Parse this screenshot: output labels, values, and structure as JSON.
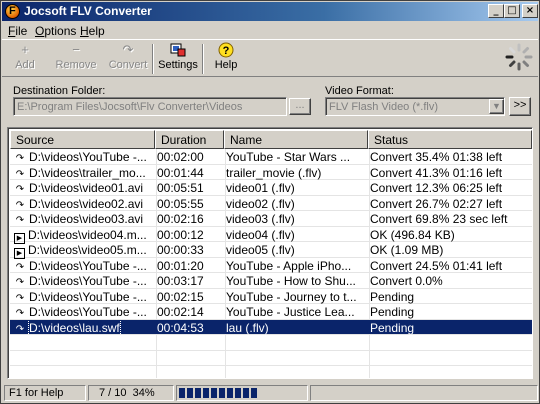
{
  "window": {
    "title": "Jocsoft FLV Converter",
    "app_icon_letter": "F"
  },
  "menu": [
    {
      "label": "File",
      "underline": "F"
    },
    {
      "label": "Options",
      "underline": "O"
    },
    {
      "label": "Help",
      "underline": "H"
    }
  ],
  "toolbar": {
    "add": {
      "label": "Add",
      "icon": "plus-icon",
      "enabled": false
    },
    "remove": {
      "label": "Remove",
      "icon": "minus-icon",
      "enabled": false
    },
    "convert": {
      "label": "Convert",
      "icon": "convert-icon",
      "enabled": false
    },
    "settings": {
      "label": "Settings",
      "icon": "settings-icon",
      "enabled": true
    },
    "help": {
      "label": "Help",
      "icon": "question-icon",
      "enabled": true
    }
  },
  "destination": {
    "label": "Destination Folder:",
    "value": "E:\\Program Files\\Jocsoft\\Flv Converter\\Videos",
    "browse_label": "..."
  },
  "format": {
    "label": "Video Format:",
    "value": "FLV Flash Video (*.flv)",
    "next_label": ">>"
  },
  "columns": [
    "Source",
    "Duration",
    "Name",
    "Status"
  ],
  "rows": [
    {
      "icon": "convert",
      "source": "D:\\videos\\YouTube -...",
      "duration": "00:02:00",
      "name": "YouTube - Star Wars ...",
      "status": "Convert 35.4%  01:38 left"
    },
    {
      "icon": "convert",
      "source": "D:\\videos\\trailer_mo...",
      "duration": "00:01:44",
      "name": "trailer_movie (.flv)",
      "status": "Convert 41.3%  01:16 left"
    },
    {
      "icon": "convert",
      "source": "D:\\videos\\video01.avi",
      "duration": "00:05:51",
      "name": "video01 (.flv)",
      "status": "Convert 12.3%  06:25 left"
    },
    {
      "icon": "convert",
      "source": "D:\\videos\\video02.avi",
      "duration": "00:05:55",
      "name": "video02 (.flv)",
      "status": "Convert 26.7%  02:27 left"
    },
    {
      "icon": "convert",
      "source": "D:\\videos\\video03.avi",
      "duration": "00:02:16",
      "name": "video03 (.flv)",
      "status": "Convert 69.8%  23 sec left"
    },
    {
      "icon": "done",
      "source": "D:\\videos\\video04.m...",
      "duration": "00:00:12",
      "name": "video04 (.flv)",
      "status": "OK    (496.84 KB)"
    },
    {
      "icon": "done",
      "source": "D:\\videos\\video05.m...",
      "duration": "00:00:33",
      "name": "video05 (.flv)",
      "status": "OK    (1.09 MB)"
    },
    {
      "icon": "convert",
      "source": "D:\\videos\\YouTube -...",
      "duration": "00:01:20",
      "name": "YouTube - Apple iPho...",
      "status": "Convert 24.5%  01:41 left"
    },
    {
      "icon": "convert",
      "source": "D:\\videos\\YouTube -...",
      "duration": "00:03:17",
      "name": "YouTube - How to Shu...",
      "status": "Convert 0.0%"
    },
    {
      "icon": "convert",
      "source": "D:\\videos\\YouTube -...",
      "duration": "00:02:15",
      "name": "YouTube - Journey to t...",
      "status": "Pending"
    },
    {
      "icon": "convert",
      "source": "D:\\videos\\YouTube -...",
      "duration": "00:02:14",
      "name": "YouTube - Justice Lea...",
      "status": "Pending"
    },
    {
      "icon": "convert",
      "source": "D:\\videos\\lau.swf",
      "duration": "00:04:53",
      "name": "lau (.flv)",
      "status": "Pending",
      "selected": true
    }
  ],
  "empty_rows": 3,
  "statusbar": {
    "help": "F1 for Help",
    "count": "7 / 10",
    "percent": "34%",
    "progress_fraction": 0.34
  },
  "colors": {
    "titlebar": "#0a246a",
    "selection": "#0a246a",
    "face": "#d4d0c8"
  }
}
